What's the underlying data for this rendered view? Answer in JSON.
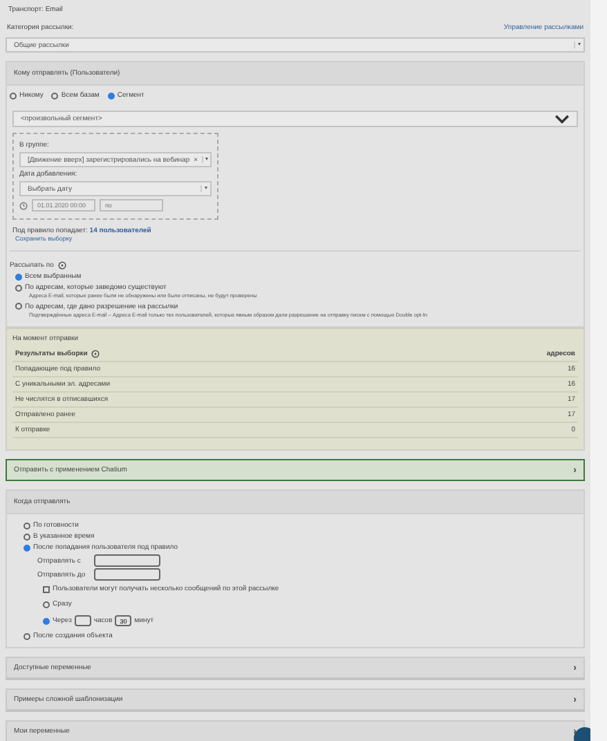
{
  "transport": "Транспорт: Email",
  "category": {
    "label": "Категория рассылки:",
    "link": "Управление рассылками",
    "value": "Общие рассылки"
  },
  "dropdown_arrow": "▾",
  "chevron": "›",
  "recipients": {
    "title": "Кому отправлять (Пользователи)",
    "modes": [
      {
        "label": "Никому",
        "selected": false
      },
      {
        "label": "Всем базам",
        "selected": false
      },
      {
        "label": "Сегмент",
        "selected": true
      }
    ],
    "segment": "<произвольный сегмент>",
    "group_label": "В группе:",
    "group_value": "[Движение вверх] зарегистрировались на вебинар",
    "remove_mark": "×",
    "date_label": "Дата добавления:",
    "date_placeholder": "Выбрать дату",
    "date_from": "01.01.2020 00:00",
    "date_to_placeholder": "по",
    "matched": "Под правило попадает: **14 пользователей**",
    "save_link": "Сохранить выборку",
    "send_by_label": "Рассылать по",
    "send_by": [
      {
        "label": "Всем выбранным",
        "selected": true
      },
      {
        "label": "По адресам, которые заведомо существуют",
        "hint": "Адреса E-mail, которые ранее были не обнаружены или были отписаны, не будут проверены",
        "selected": false
      },
      {
        "label": "По адресам, где дано разрешение на рассылки",
        "hint": "Подтверждённые адреса E-mail – Адреса E-mail только тех пользователей, которые явным образом дали разрешение на отправку писем с помощью Double opt-In",
        "selected": false
      }
    ]
  },
  "stats": {
    "caption": "На момент отправки",
    "heading": "Результаты выборки",
    "unit": "адресов",
    "rows": [
      {
        "label": "Попадающие под правило",
        "value": "16"
      },
      {
        "label": "С уникальными эл. адресами",
        "value": "16"
      },
      {
        "label": "Не числятся в отписавшихся",
        "value": "17"
      },
      {
        "label": "Отправлено ранее",
        "value": "17"
      },
      {
        "label": "К отправке",
        "value": "0"
      }
    ]
  },
  "chatium": {
    "title": "Отправить с применением Chatium",
    "expanded": false
  },
  "when": {
    "title": "Когда отправлять",
    "options": [
      {
        "label": "По готовности",
        "selected": false
      },
      {
        "label": "В указанное время",
        "selected": false
      },
      {
        "label": "После попадания пользователя под правило",
        "selected": true,
        "details": {
          "from_label": "Отправлять с",
          "to_label": "Отправлять до",
          "multiple": {
            "label": "Пользователи могут получать несколько сообщений по этой рассылке",
            "checked": false
          },
          "delays": [
            {
              "label": "Сразу",
              "selected": false
            },
            {
              "label": "Через",
              "hours_unit": "часов",
              "minutes": "30",
              "minutes_unit": "минут",
              "selected": true
            }
          ]
        }
      },
      {
        "label": "После создания объекта",
        "selected": false
      }
    ]
  },
  "sections": [
    {
      "title": "Доступные переменные",
      "expanded": false
    },
    {
      "title": "Примеры сложной шаблонизации",
      "expanded": false
    },
    {
      "title": "Мои переменные",
      "expanded": false
    }
  ]
}
